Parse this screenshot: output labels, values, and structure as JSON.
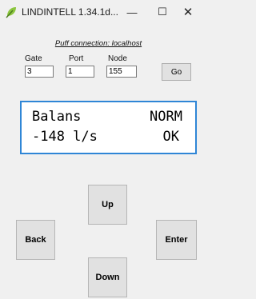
{
  "window": {
    "title": "LINDINTELL 1.34.1d...",
    "minimize_glyph": "—",
    "maximize_glyph": "☐",
    "close_glyph": "✕"
  },
  "connection": {
    "text": "Puff connection: localhost"
  },
  "fields": {
    "gate": {
      "label": "Gate",
      "value": "3"
    },
    "port": {
      "label": "Port",
      "value": "1"
    },
    "node": {
      "label": "Node",
      "value": "155"
    }
  },
  "go_label": "Go",
  "display": {
    "line1_left": "Balans",
    "line1_right": "NORM",
    "line2_left": "-148 l/s",
    "line2_right": "OK"
  },
  "nav": {
    "up": "Up",
    "back": "Back",
    "enter": "Enter",
    "down": "Down"
  },
  "colors": {
    "display_border": "#2f86d6",
    "icon_green": "#8cc63f"
  }
}
